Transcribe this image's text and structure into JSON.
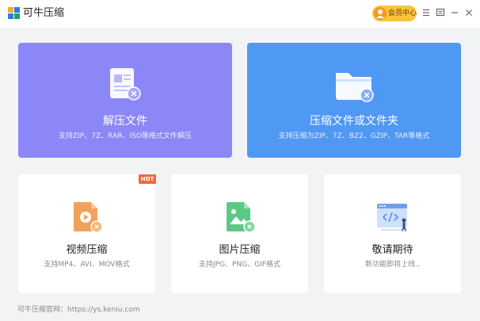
{
  "app": {
    "title": "可牛压缩"
  },
  "header": {
    "vip_label": "会员中心"
  },
  "cards": {
    "extract": {
      "title": "解压文件",
      "subtitle": "支持ZIP、7Z、RAR、ISO等格式文件解压",
      "color": "#8c87f6"
    },
    "compress": {
      "title": "压缩文件或文件夹",
      "subtitle": "支持压缩为ZIP、7Z、BZ2、GZIP、TAR等格式",
      "color": "#4f98f4"
    },
    "video": {
      "title": "视频压缩",
      "subtitle": "支持MP4、AVI、MOV格式",
      "badge": "HOT"
    },
    "image": {
      "title": "图片压缩",
      "subtitle": "支持JPG、PNG、GIF格式"
    },
    "coming": {
      "title": "敬请期待",
      "subtitle": "新功能即将上线.."
    }
  },
  "footer": {
    "text": "可牛压缩官网：https://ys.keniu.com"
  },
  "icons": {
    "logo": "app-logo-icon",
    "menu": "menu-icon",
    "feedback": "feedback-icon",
    "minimize": "minimize-icon",
    "close": "close-icon"
  }
}
